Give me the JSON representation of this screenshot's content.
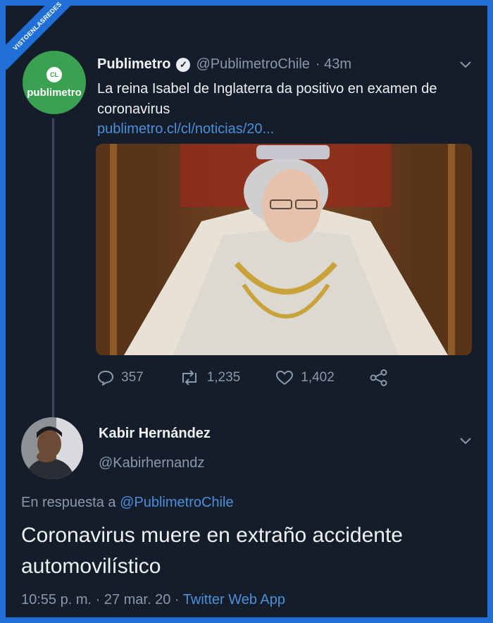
{
  "watermark": "VISTOENLASREDES",
  "tweet1": {
    "avatar_badge": "CL",
    "avatar_brand": "publimetro",
    "name": "Publimetro",
    "verified_mark": "✓",
    "handle": "@PublimetroChile",
    "time": "· 43m",
    "text": "La reina Isabel de Inglaterra da positivo en examen de coronavirus",
    "link": "publimetro.cl/cl/noticias/20...",
    "replies": "357",
    "retweets": "1,235",
    "likes": "1,402"
  },
  "tweet2": {
    "name": "Kabir Hernández",
    "handle": "@Kabirhernandz",
    "reply_label": "En respuesta a",
    "reply_handle": "@PublimetroChile",
    "text": "Coronavirus muere en extraño accidente automovilístico",
    "timestamp": "10:55 p. m. · 27 mar. 20 ·",
    "app": "Twitter Web App"
  },
  "icons": [
    "reply-icon",
    "retweet-icon",
    "like-icon",
    "share-icon",
    "chevron-down-icon",
    "verified-icon"
  ],
  "colors": {
    "background": "#151d2a",
    "link": "#4a90d9",
    "muted": "#8899aa",
    "brand_green": "#3aa150",
    "frame": "#1f6fd6"
  }
}
